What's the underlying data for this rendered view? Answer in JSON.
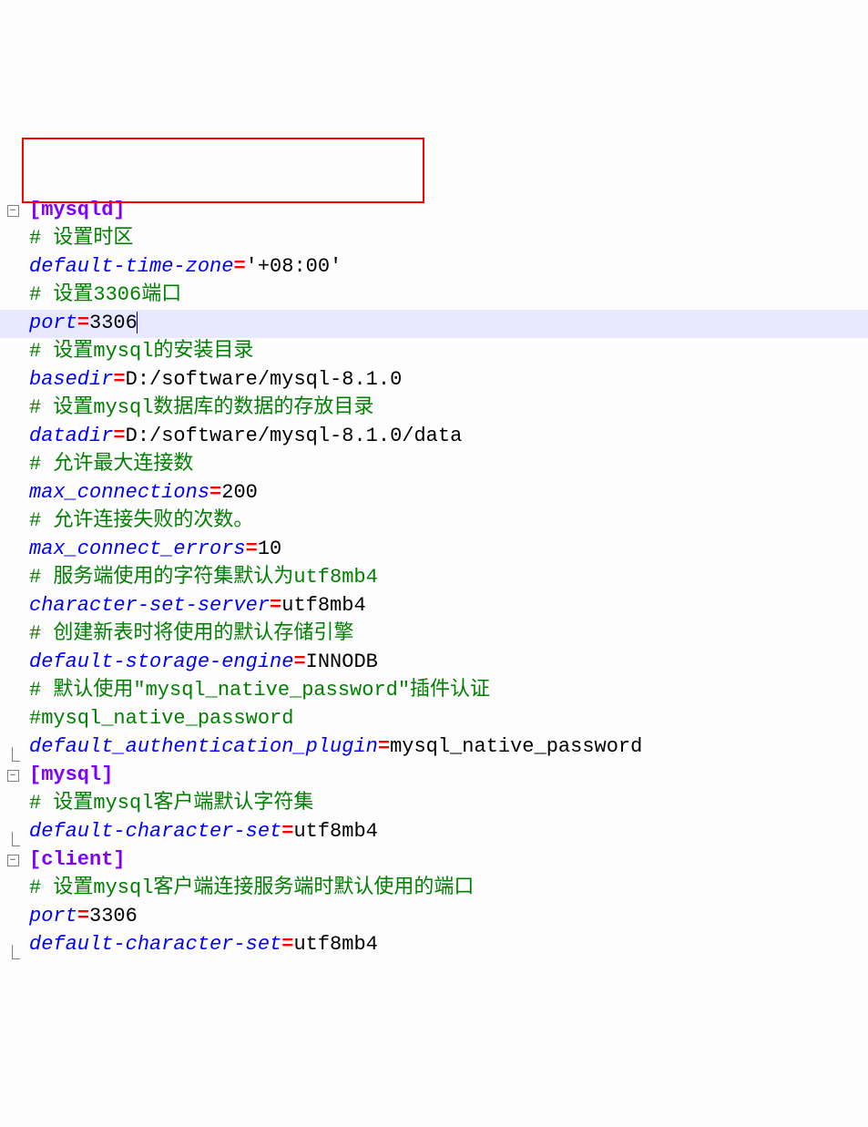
{
  "lines": [
    {
      "type": "section",
      "fold": "minus",
      "text": "[mysqld]",
      "highlight": true
    },
    {
      "type": "comment",
      "fold": "line",
      "text": "# 设置时区"
    },
    {
      "type": "kv",
      "fold": "line",
      "key": "default-time-zone",
      "value": "'+08:00'"
    },
    {
      "type": "comment",
      "fold": "line",
      "text": "# 设置3306端口"
    },
    {
      "type": "kv",
      "fold": "line",
      "key": "port",
      "value": "3306",
      "current": true,
      "cursor": true
    },
    {
      "type": "comment",
      "fold": "line",
      "text": "# 设置mysql的安装目录"
    },
    {
      "type": "kv",
      "fold": "line",
      "key": "basedir",
      "value": "D:/software/mysql-8.1.0"
    },
    {
      "type": "comment",
      "fold": "line",
      "text": "# 设置mysql数据库的数据的存放目录"
    },
    {
      "type": "kv",
      "fold": "line",
      "key": "datadir",
      "value": "D:/software/mysql-8.1.0/data"
    },
    {
      "type": "comment",
      "fold": "line",
      "text": "# 允许最大连接数"
    },
    {
      "type": "kv",
      "fold": "line",
      "key": "max_connections",
      "value": "200"
    },
    {
      "type": "comment",
      "fold": "line",
      "text": "# 允许连接失败的次数。"
    },
    {
      "type": "kv",
      "fold": "line",
      "key": "max_connect_errors",
      "value": "10"
    },
    {
      "type": "comment",
      "fold": "line",
      "text": "# 服务端使用的字符集默认为utf8mb4"
    },
    {
      "type": "kv",
      "fold": "line",
      "key": "character-set-server",
      "value": "utf8mb4"
    },
    {
      "type": "comment",
      "fold": "line",
      "text": "# 创建新表时将使用的默认存储引擎"
    },
    {
      "type": "kv",
      "fold": "line",
      "key": "default-storage-engine",
      "value": "INNODB"
    },
    {
      "type": "comment",
      "fold": "line",
      "text": "# 默认使用\"mysql_native_password\"插件认证"
    },
    {
      "type": "comment",
      "fold": "line",
      "text": "#mysql_native_password"
    },
    {
      "type": "kv",
      "fold": "corner",
      "key": "default_authentication_plugin",
      "value": "mysql_native_password"
    },
    {
      "type": "section",
      "fold": "minus",
      "text": "[mysql]"
    },
    {
      "type": "comment",
      "fold": "line",
      "text": "# 设置mysql客户端默认字符集"
    },
    {
      "type": "kv",
      "fold": "corner",
      "key": "default-character-set",
      "value": "utf8mb4"
    },
    {
      "type": "section",
      "fold": "minus",
      "text": "[client]"
    },
    {
      "type": "comment",
      "fold": "line",
      "text": "# 设置mysql客户端连接服务端时默认使用的端口"
    },
    {
      "type": "kv",
      "fold": "line",
      "key": "port",
      "value": "3306"
    },
    {
      "type": "kv",
      "fold": "corner",
      "key": "default-character-set",
      "value": "utf8mb4"
    }
  ],
  "fold_minus": "−",
  "highlight_region": {
    "enabled": true
  }
}
